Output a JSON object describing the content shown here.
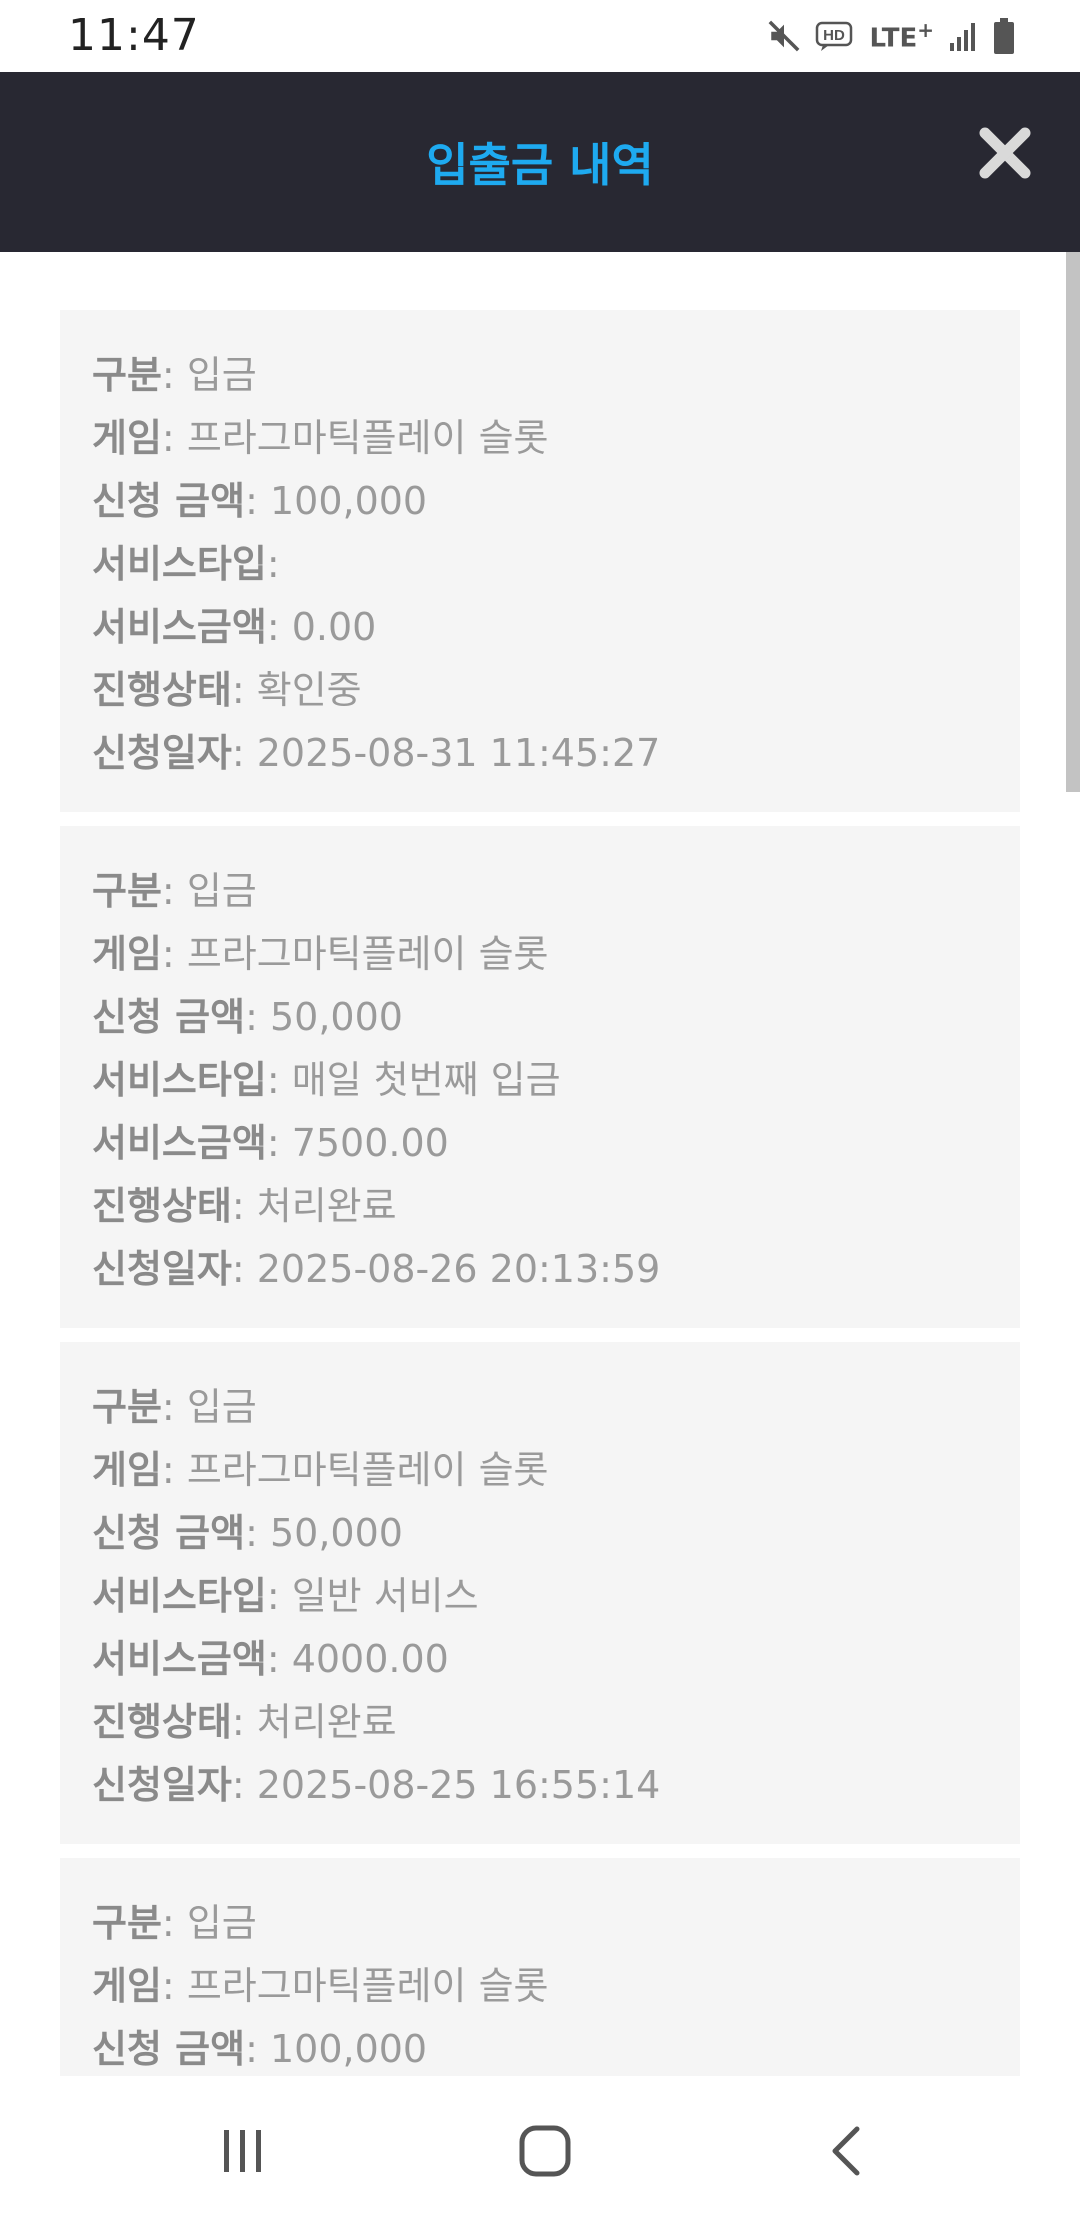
{
  "status_bar": {
    "time": "11:47",
    "icons": [
      "mute-icon",
      "hd-voice-icon",
      "lte-plus-icon",
      "signal-icon",
      "battery-icon"
    ],
    "network_label": "LTE",
    "network_superscript": "+"
  },
  "header": {
    "title": "입출금 내역",
    "close_icon": "close-icon",
    "background": "#282832",
    "title_color": "#1eaaf0"
  },
  "records": [
    {
      "type_label": "구분",
      "type_value": "입금",
      "game_label": "게임",
      "game_value": "프라그마틱플레이 슬롯",
      "amount_label": "신청 금액",
      "amount_value": "100,000",
      "service_type_label": "서비스타입",
      "service_type_value": "",
      "service_amount_label": "서비스금액",
      "service_amount_value": "0.00",
      "status_label": "진행상태",
      "status_value": "확인중",
      "date_label": "신청일자",
      "date_value": "2025-08-31 11:45:27"
    },
    {
      "type_label": "구분",
      "type_value": "입금",
      "game_label": "게임",
      "game_value": "프라그마틱플레이 슬롯",
      "amount_label": "신청 금액",
      "amount_value": "50,000",
      "service_type_label": "서비스타입",
      "service_type_value": "매일 첫번째 입금",
      "service_amount_label": "서비스금액",
      "service_amount_value": "7500.00",
      "status_label": "진행상태",
      "status_value": "처리완료",
      "date_label": "신청일자",
      "date_value": "2025-08-26 20:13:59"
    },
    {
      "type_label": "구분",
      "type_value": "입금",
      "game_label": "게임",
      "game_value": "프라그마틱플레이 슬롯",
      "amount_label": "신청 금액",
      "amount_value": "50,000",
      "service_type_label": "서비스타입",
      "service_type_value": "일반 서비스",
      "service_amount_label": "서비스금액",
      "service_amount_value": "4000.00",
      "status_label": "진행상태",
      "status_value": "처리완료",
      "date_label": "신청일자",
      "date_value": "2025-08-25 16:55:14"
    },
    {
      "type_label": "구분",
      "type_value": "입금",
      "game_label": "게임",
      "game_value": "프라그마틱플레이 슬롯",
      "amount_label": "신청 금액",
      "amount_value": "100,000"
    }
  ],
  "nav_bar": {
    "icons": [
      "recent-apps-icon",
      "home-icon",
      "back-icon"
    ]
  }
}
